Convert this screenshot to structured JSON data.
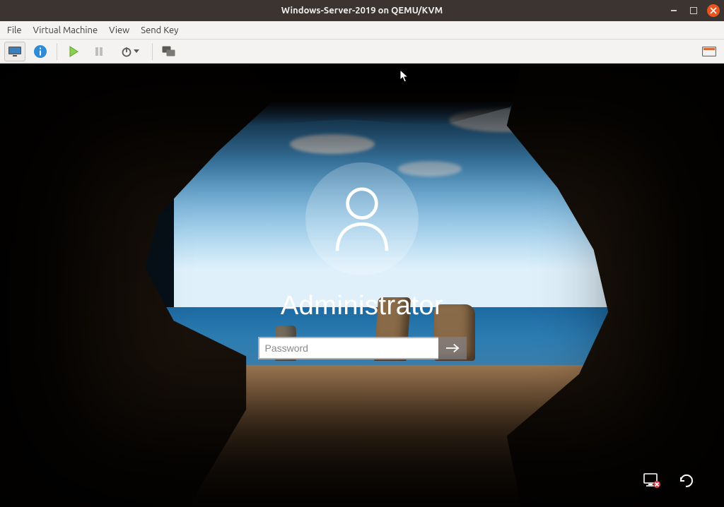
{
  "window": {
    "title": "Windows-Server-2019 on QEMU/KVM"
  },
  "menubar": {
    "items": [
      "File",
      "Virtual Machine",
      "View",
      "Send Key"
    ]
  },
  "toolbar": {
    "console_icon": "console-icon",
    "info_icon": "info-icon",
    "play_icon": "play-icon",
    "pause_icon": "pause-icon",
    "power_icon": "power-menu-icon",
    "snapshot_icon": "snapshot-icon",
    "fullscreen_icon": "fullscreen-icon"
  },
  "login": {
    "username": "Administrator",
    "password_placeholder": "Password"
  },
  "logon_options": {
    "network_icon": "network-signin-icon",
    "ease_icon": "ease-of-access-icon"
  }
}
